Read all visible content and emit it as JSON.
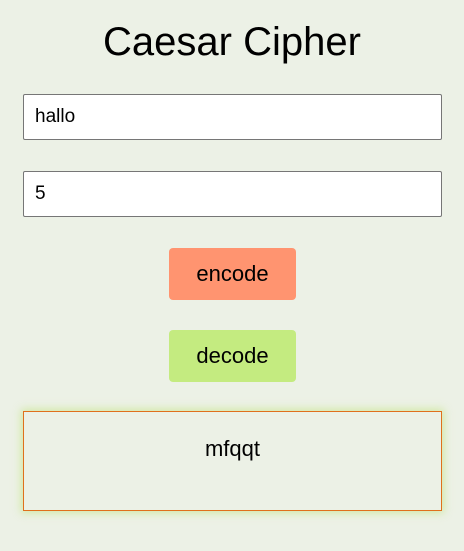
{
  "page": {
    "title": "Caesar Cipher"
  },
  "form": {
    "message_value": "hallo",
    "shift_value": "5"
  },
  "buttons": {
    "encode_label": "encode",
    "decode_label": "decode"
  },
  "output": {
    "result": "mfqqt"
  },
  "colors": {
    "background": "#ecf1e6",
    "encode_button": "#ff9470",
    "decode_button": "#c4eb80",
    "output_border": "#e0701c"
  }
}
